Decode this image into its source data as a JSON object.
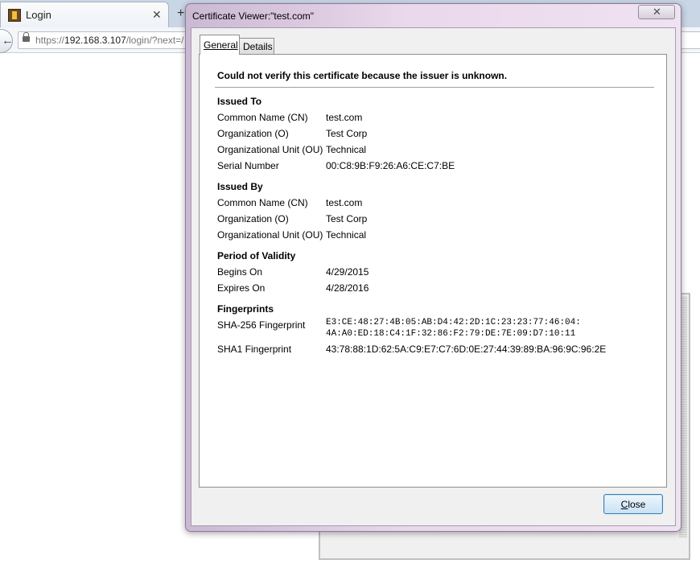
{
  "browser": {
    "tab_title": "Login",
    "tab_close_glyph": "✕",
    "new_tab_glyph": "+",
    "url_host": "192.168.3.107",
    "url_scheme": "https://",
    "url_path": "/login/?next=/"
  },
  "dialog": {
    "title": "Certificate Viewer:\"test.com\"",
    "tabs": [
      {
        "label": "General",
        "selected": true
      },
      {
        "label": "Details",
        "selected": false
      }
    ],
    "warning": "Could not verify this certificate because the issuer is unknown.",
    "issued_to": {
      "heading": "Issued To",
      "rows": [
        {
          "label": "Common Name (CN)",
          "value": "test.com"
        },
        {
          "label": "Organization (O)",
          "value": "Test Corp"
        },
        {
          "label": "Organizational Unit (OU)",
          "value": "Technical"
        },
        {
          "label": "Serial Number",
          "value": "00:C8:9B:F9:26:A6:CE:C7:BE"
        }
      ]
    },
    "issued_by": {
      "heading": "Issued By",
      "rows": [
        {
          "label": "Common Name (CN)",
          "value": "test.com"
        },
        {
          "label": "Organization (O)",
          "value": "Test Corp"
        },
        {
          "label": "Organizational Unit (OU)",
          "value": "Technical"
        }
      ]
    },
    "validity": {
      "heading": "Period of Validity",
      "rows": [
        {
          "label": "Begins On",
          "value": "4/29/2015"
        },
        {
          "label": "Expires On",
          "value": "4/28/2016"
        }
      ]
    },
    "fingerprints": {
      "heading": "Fingerprints",
      "sha256_label": "SHA-256 Fingerprint",
      "sha256_line1": "E3:CE:48:27:4B:05:AB:D4:42:2D:1C:23:23:77:46:04:",
      "sha256_line2": "4A:A0:ED:18:C4:1F:32:86:F2:79:DE:7E:09:D7:10:11",
      "sha1_label": "SHA1 Fingerprint",
      "sha1_value": "43:78:88:1D:62:5A:C9:E7:C7:6D:0E:27:44:39:89:BA:96:9C:96:2E"
    },
    "close_label": "Close",
    "titlebar_close_glyph": "✕"
  },
  "colors": {
    "dialog_frame": "#ead8ec",
    "button_border": "#3c7fb1",
    "tabstrip": "#c9d6e6"
  }
}
